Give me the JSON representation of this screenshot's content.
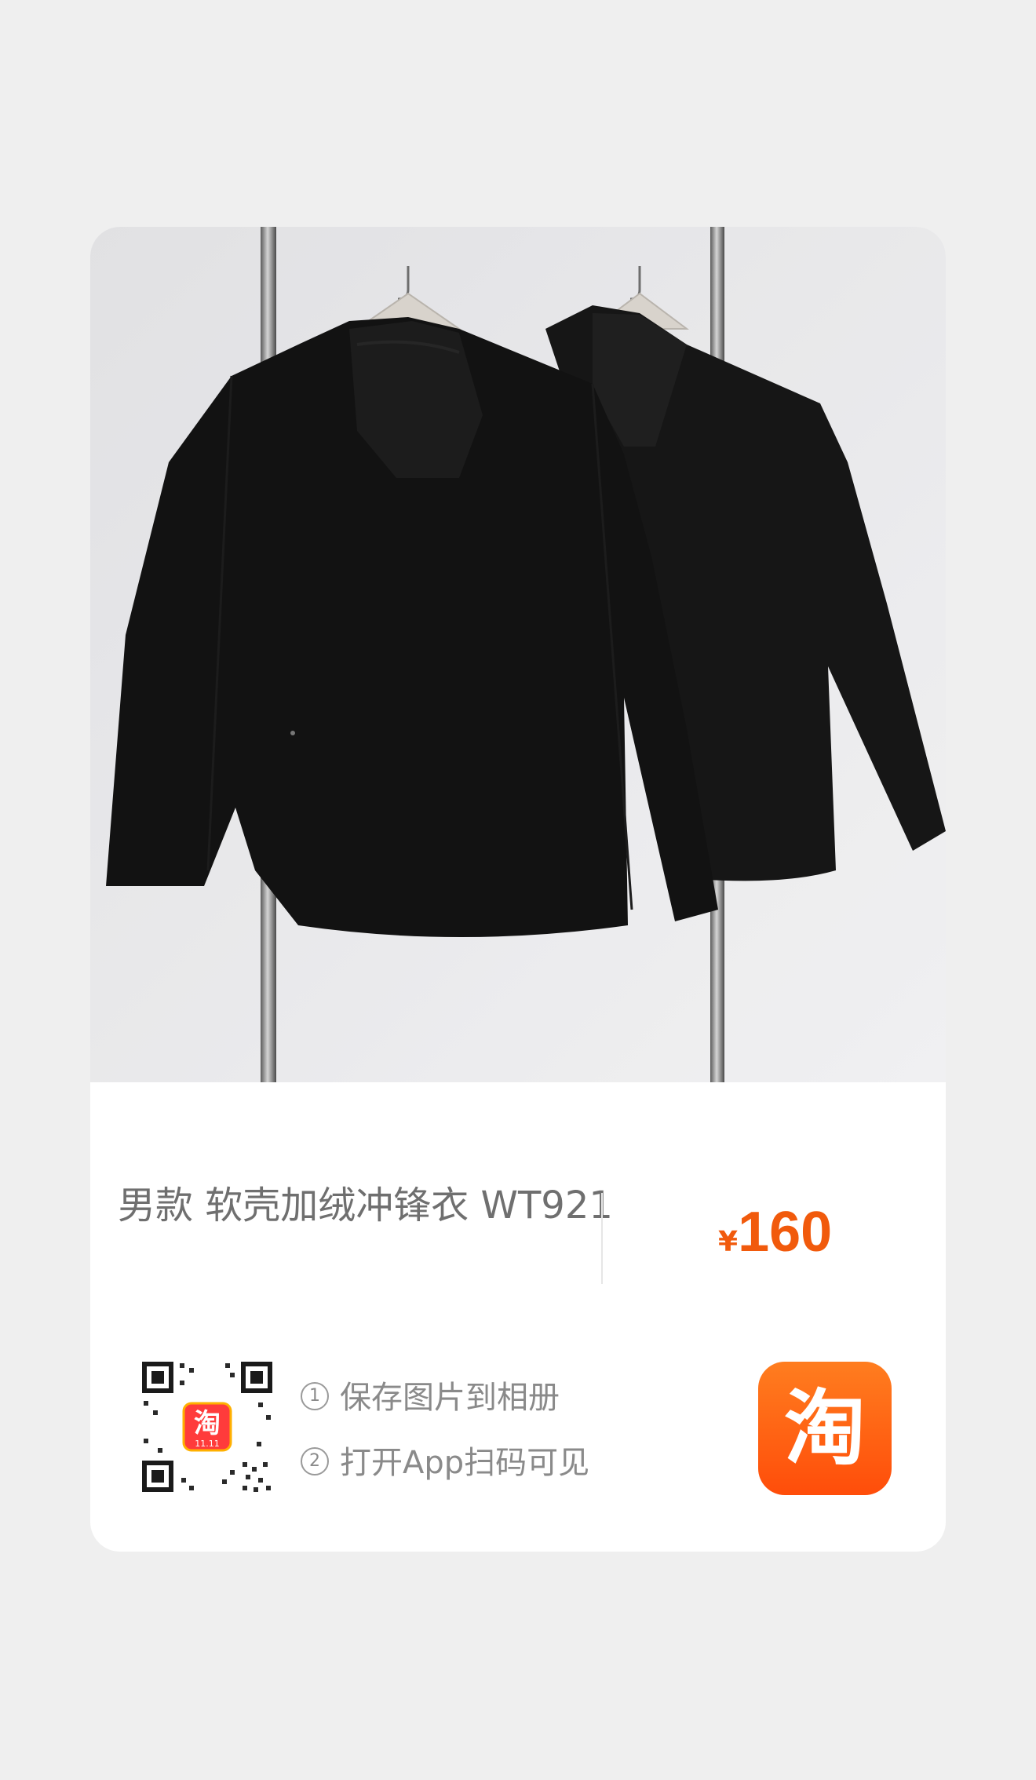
{
  "product": {
    "title": "男款 软壳加绒冲锋衣 WT921",
    "currency_symbol": "¥",
    "price": "160",
    "image_icon": "product-photo-two-black-hooded-jackets",
    "price_color": "#f15a0c"
  },
  "instructions": {
    "step1_number": "1",
    "step1_text": "保存图片到相册",
    "step2_number": "2",
    "step2_text": "打开App扫码可见"
  },
  "qr": {
    "badge_char": "淘",
    "badge_sub": "11.11"
  },
  "app_logo": {
    "char": "淘",
    "color": "#ff5a0f"
  }
}
